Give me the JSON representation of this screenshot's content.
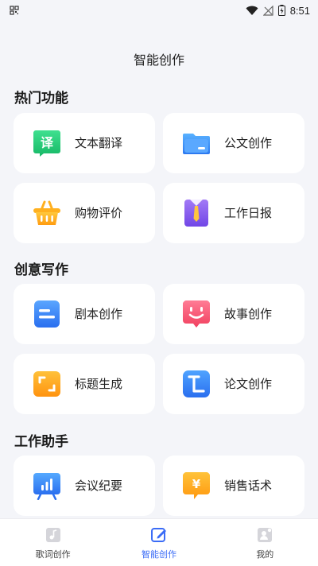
{
  "status": {
    "time": "8:51"
  },
  "page_title": "智能创作",
  "sections": [
    {
      "title": "热门功能"
    },
    {
      "title": "创意写作"
    },
    {
      "title": "工作助手"
    }
  ],
  "cards": {
    "translate": "文本翻译",
    "official_doc": "公文创作",
    "shopping_review": "购物评价",
    "daily_report": "工作日报",
    "script": "剧本创作",
    "story": "故事创作",
    "headline": "标题生成",
    "thesis": "论文创作",
    "meeting": "会议纪要",
    "sales": "销售话术"
  },
  "icons": {
    "translate_glyph": "译",
    "sales_glyph": "¥"
  },
  "tabs": [
    {
      "label": "歌词创作",
      "icon": "lyrics-icon",
      "active": false
    },
    {
      "label": "智能创作",
      "icon": "pen-edit-icon",
      "active": true
    },
    {
      "label": "我的",
      "icon": "profile-icon",
      "active": false
    }
  ],
  "colors": {
    "accent": "#3b6cf6",
    "green": "#2ed17a",
    "blue": "#3a8df5",
    "orange": "#ffb01f",
    "purple": "#8a5cf0",
    "pink": "#f5587a"
  }
}
